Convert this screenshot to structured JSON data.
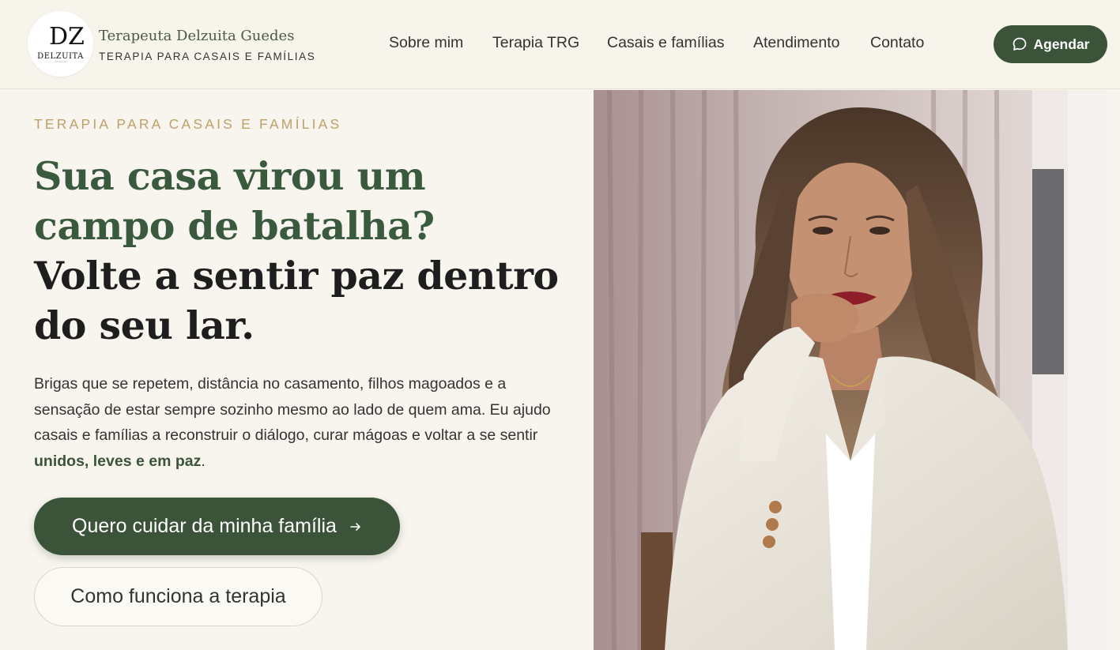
{
  "header": {
    "logo": {
      "monogram": "DZ",
      "wordmark": "DELZUITA"
    },
    "brand_name": "Terapeuta Delzuita Guedes",
    "brand_tagline": "TERAPIA PARA CASAIS E FAMÍLIAS",
    "nav": [
      {
        "label": "Sobre mim"
      },
      {
        "label": "Terapia TRG"
      },
      {
        "label": "Casais e famílias"
      },
      {
        "label": "Atendimento"
      },
      {
        "label": "Contato"
      }
    ],
    "cta": {
      "label": "Agendar",
      "icon": "chat-bubble-icon"
    }
  },
  "hero": {
    "eyebrow": "TERAPIA PARA CASAIS E FAMÍLIAS",
    "headline_question": "Sua casa virou um campo de batalha?",
    "headline_answer": "Volte a sentir paz dentro do seu lar.",
    "lede_text": "Brigas que se repetem, distância no casamento, filhos magoados e a sensação de estar sempre sozinho mesmo ao lado de quem ama. Eu ajudo casais e famílias a reconstruir o diálogo, curar mágoas e voltar a se sentir ",
    "lede_emphasis": "unidos, leves e em paz",
    "lede_end": ".",
    "cta_primary": {
      "label": "Quero cuidar da minha família",
      "icon": "arrow-right-icon"
    },
    "cta_secondary": {
      "label": "Como funciona a terapia"
    },
    "photo": {
      "subject": "portrait of therapist in white blazer"
    }
  },
  "colors": {
    "background": "#f8f5ee",
    "brand_green": "#3a5339",
    "headline_green": "#3a5a3e",
    "accent_gold": "#bfa06a",
    "text_dark": "#1e1e1e"
  }
}
